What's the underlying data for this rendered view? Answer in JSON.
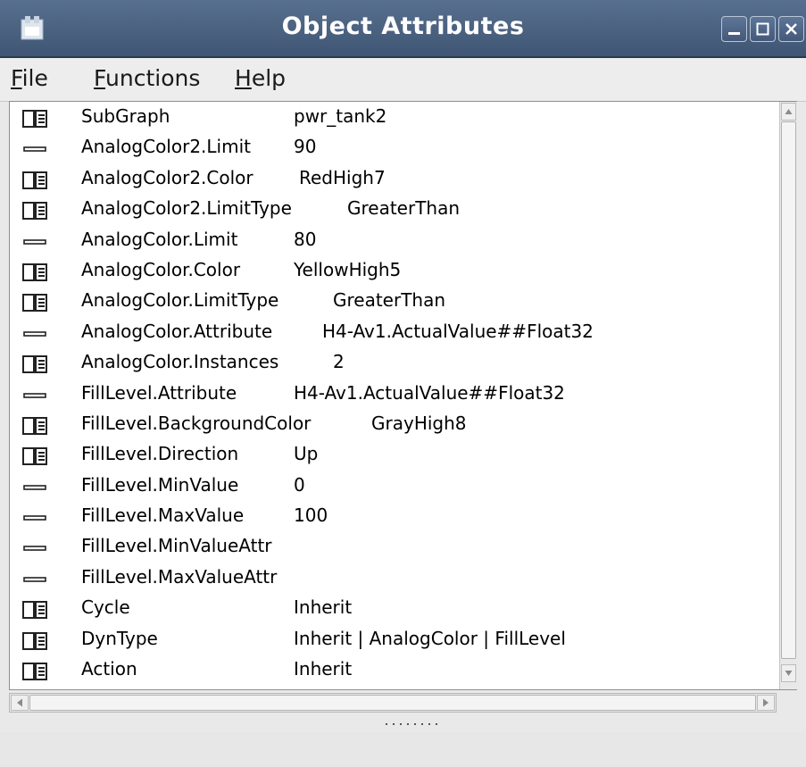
{
  "window": {
    "title": "Object Attributes",
    "buttons": [
      "minimize",
      "maximize",
      "close"
    ]
  },
  "menu": [
    {
      "mnemonic": "F",
      "rest": "ile"
    },
    {
      "mnemonic": "F",
      "rest": "unctions"
    },
    {
      "mnemonic": "H",
      "rest": "elp"
    }
  ],
  "attributes": [
    {
      "icon": "enum-icon",
      "name": "SubGraph",
      "value": "pwr_tank2"
    },
    {
      "icon": "value-icon",
      "name": "AnalogColor2.Limit",
      "value": "90"
    },
    {
      "icon": "enum-icon",
      "name": "AnalogColor2.Color",
      "value": "RedHigh7"
    },
    {
      "icon": "enum-icon",
      "name": "AnalogColor2.LimitType",
      "value": "GreaterThan"
    },
    {
      "icon": "value-icon",
      "name": "AnalogColor.Limit",
      "value": "80"
    },
    {
      "icon": "enum-icon",
      "name": "AnalogColor.Color",
      "value": "YellowHigh5"
    },
    {
      "icon": "enum-icon",
      "name": "AnalogColor.LimitType",
      "value": "GreaterThan"
    },
    {
      "icon": "value-icon",
      "name": "AnalogColor.Attribute",
      "value": "H4-Av1.ActualValue##Float32"
    },
    {
      "icon": "enum-icon",
      "name": "AnalogColor.Instances",
      "value": "2"
    },
    {
      "icon": "value-icon",
      "name": "FillLevel.Attribute",
      "value": "H4-Av1.ActualValue##Float32"
    },
    {
      "icon": "enum-icon",
      "name": "FillLevel.BackgroundColor",
      "value": "GrayHigh8"
    },
    {
      "icon": "enum-icon",
      "name": "FillLevel.Direction",
      "value": "Up"
    },
    {
      "icon": "value-icon",
      "name": "FillLevel.MinValue",
      "value": "0"
    },
    {
      "icon": "value-icon",
      "name": "FillLevel.MaxValue",
      "value": "100"
    },
    {
      "icon": "value-icon",
      "name": "FillLevel.MinValueAttr",
      "value": ""
    },
    {
      "icon": "value-icon",
      "name": "FillLevel.MaxValueAttr",
      "value": ""
    },
    {
      "icon": "enum-icon",
      "name": "Cycle",
      "value": "Inherit"
    },
    {
      "icon": "enum-icon",
      "name": "DynType",
      "value": "Inherit | AnalogColor | FillLevel"
    },
    {
      "icon": "enum-icon",
      "name": "Action",
      "value": "Inherit"
    }
  ]
}
